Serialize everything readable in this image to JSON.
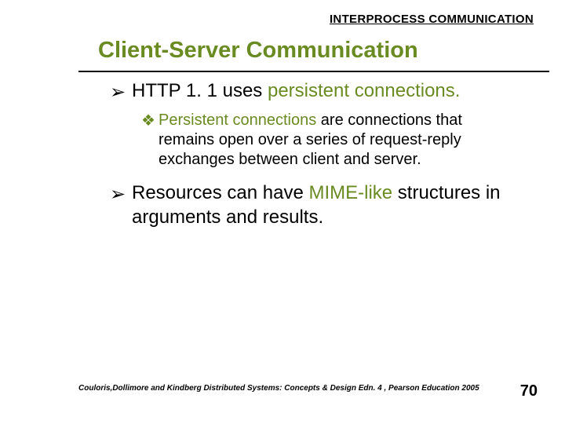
{
  "header": {
    "label": "INTERPROCESS COMMUNICATION"
  },
  "title": "Client-Server Communication",
  "bullets": {
    "b1": {
      "pre": "HTTP 1. 1 uses ",
      "hl": "persistent connections.",
      "post": ""
    },
    "b1sub": {
      "pre": "",
      "hl": "Persistent connections",
      "post": " are connections that remains open over a series of request-reply exchanges between client and server."
    },
    "b2": {
      "pre": "Resources can have ",
      "hl": "MIME-like",
      "post": " structures in arguments and results."
    }
  },
  "glyphs": {
    "arrow": "➢",
    "diamond": "❖"
  },
  "footer": {
    "citation": "Couloris,Dollimore and Kindberg  Distributed Systems: Concepts & Design  Edn. 4 ,  Pearson Education 2005",
    "page": "70"
  }
}
